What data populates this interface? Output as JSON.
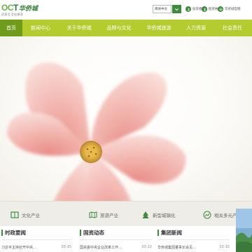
{
  "header": {
    "logo_brand": "OCT",
    "logo_cn": "华侨城",
    "logo_tagline": "优质生活创想家",
    "lang_select": "简体中文",
    "quick_links": [
      {
        "label": "投资者",
        "icon": "user-icon"
      },
      {
        "label": "招贤纳",
        "icon": "person-icon"
      },
      {
        "label": "华侨城官网",
        "icon": "globe-icon"
      }
    ]
  },
  "nav": {
    "items": [
      "首页",
      "新闻中心",
      "关于华侨城",
      "品牌与文化",
      "华侨城旅游",
      "人力资源",
      "社会责任"
    ],
    "active_index": 0
  },
  "band": {
    "items": [
      {
        "label": "文化产业",
        "icon": "book-icon"
      },
      {
        "label": "旅游产业",
        "icon": "map-icon"
      },
      {
        "label": "新型城镇化",
        "icon": "city-icon"
      },
      {
        "label": "相关多元产业",
        "icon": "chart-icon"
      }
    ]
  },
  "news": {
    "columns": [
      {
        "title": "时政要闻",
        "headline": "习近平主持召开中央…",
        "date": "03-15"
      },
      {
        "title": "国资动态",
        "headline": "国资委中央企业改革工作…",
        "date": "03-12"
      },
      {
        "title": "集团新闻",
        "headline": "华侨城集团董事长会见…",
        "date": "03-15"
      }
    ]
  },
  "colors": {
    "nav_bg": "#b5cc2e",
    "nav_active": "#6f9d1b",
    "brand_green": "#3c8a3c",
    "petal_pink": "#f2b4ad"
  }
}
